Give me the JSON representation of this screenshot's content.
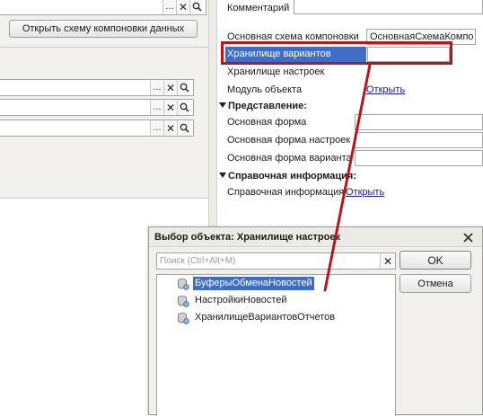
{
  "left": {
    "open_scheme_button": "Открыть схему компоновки данных",
    "clear_symbol": "✕",
    "select_symbol": "..."
  },
  "properties": {
    "comment_label": "Комментарий",
    "main_scheme_label": "Основная схема компоновки",
    "main_scheme_value": "ОсновнаяСхемаКомпо",
    "variants_storage_label": "Хранилище вариантов",
    "settings_storage_label": "Хранилище настроек",
    "object_module_label": "Модуль объекта",
    "object_module_link": "Открыть",
    "presentation_section": "Представление:",
    "main_form_label": "Основная форма",
    "settings_form_label": "Основная форма настроек",
    "variant_form_label": "Основная форма варианта",
    "reference_section": "Справочная информация:",
    "reference_label": "Справочная информация",
    "reference_link": "Открыть"
  },
  "dialog": {
    "title": "Выбор объекта: Хранилище настроек",
    "close_symbol": "✕",
    "search_placeholder": "Поиск (Ctrl+Alt+M)",
    "ok_label": "OK",
    "cancel_label": "Отмена",
    "items": [
      {
        "label": "БуферыОбменаНовостей",
        "selected": true
      },
      {
        "label": "НастройкиНовостей",
        "selected": false
      },
      {
        "label": "ХранилищеВариантовОтчетов",
        "selected": false
      }
    ]
  },
  "colors": {
    "highlight": "#b3181a",
    "selection": "#3f6cc4",
    "link": "#1a1a86"
  }
}
